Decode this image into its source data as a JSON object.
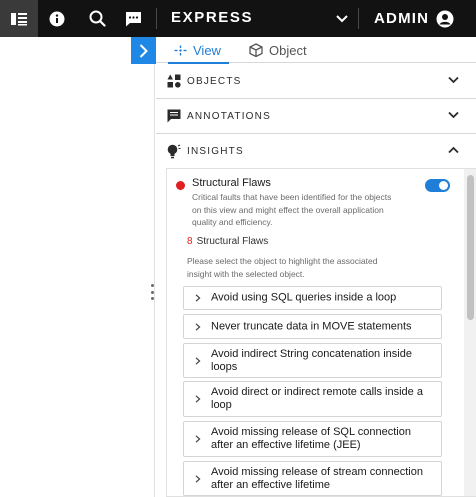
{
  "header": {
    "app_title": "EXPRESS",
    "user": "ADMIN",
    "icons": [
      "layout-icon",
      "info-icon",
      "search-icon",
      "chat-icon",
      "chevron-down-icon",
      "user-avatar-icon"
    ]
  },
  "tabs": [
    {
      "label": "View",
      "icon": "view-icon",
      "active": true
    },
    {
      "label": "Object",
      "icon": "cube-icon",
      "active": false
    }
  ],
  "sections": {
    "objects": {
      "label": "OBJECTS",
      "icon": "shapes-icon",
      "expanded": false
    },
    "annotations": {
      "label": "ANNOTATIONS",
      "icon": "comment-icon",
      "expanded": false
    },
    "insights": {
      "label": "INSIGHTS",
      "icon": "lightbulb-icon",
      "expanded": true
    }
  },
  "insights": {
    "title": "Structural Flaws",
    "description": "Critical faults that have been identified for the objects on this view and might effect the overall application quality and efficiency.",
    "toggle_on": true,
    "count": "8",
    "count_label": "Structural Flaws",
    "hint": "Please select the object to highlight the associated insight with the selected object.",
    "flaws": [
      "Avoid using SQL queries inside a loop",
      "Never truncate data in MOVE statements",
      "Avoid indirect String concatenation inside loops",
      "Avoid direct or indirect remote calls inside a loop",
      "Avoid missing release of SQL connection after an effective lifetime (JEE)",
      "Avoid missing release of stream connection after an effective lifetime"
    ]
  },
  "colors": {
    "accent": "#1f7fd8",
    "topbar": "#121212",
    "alert": "#e02020"
  }
}
